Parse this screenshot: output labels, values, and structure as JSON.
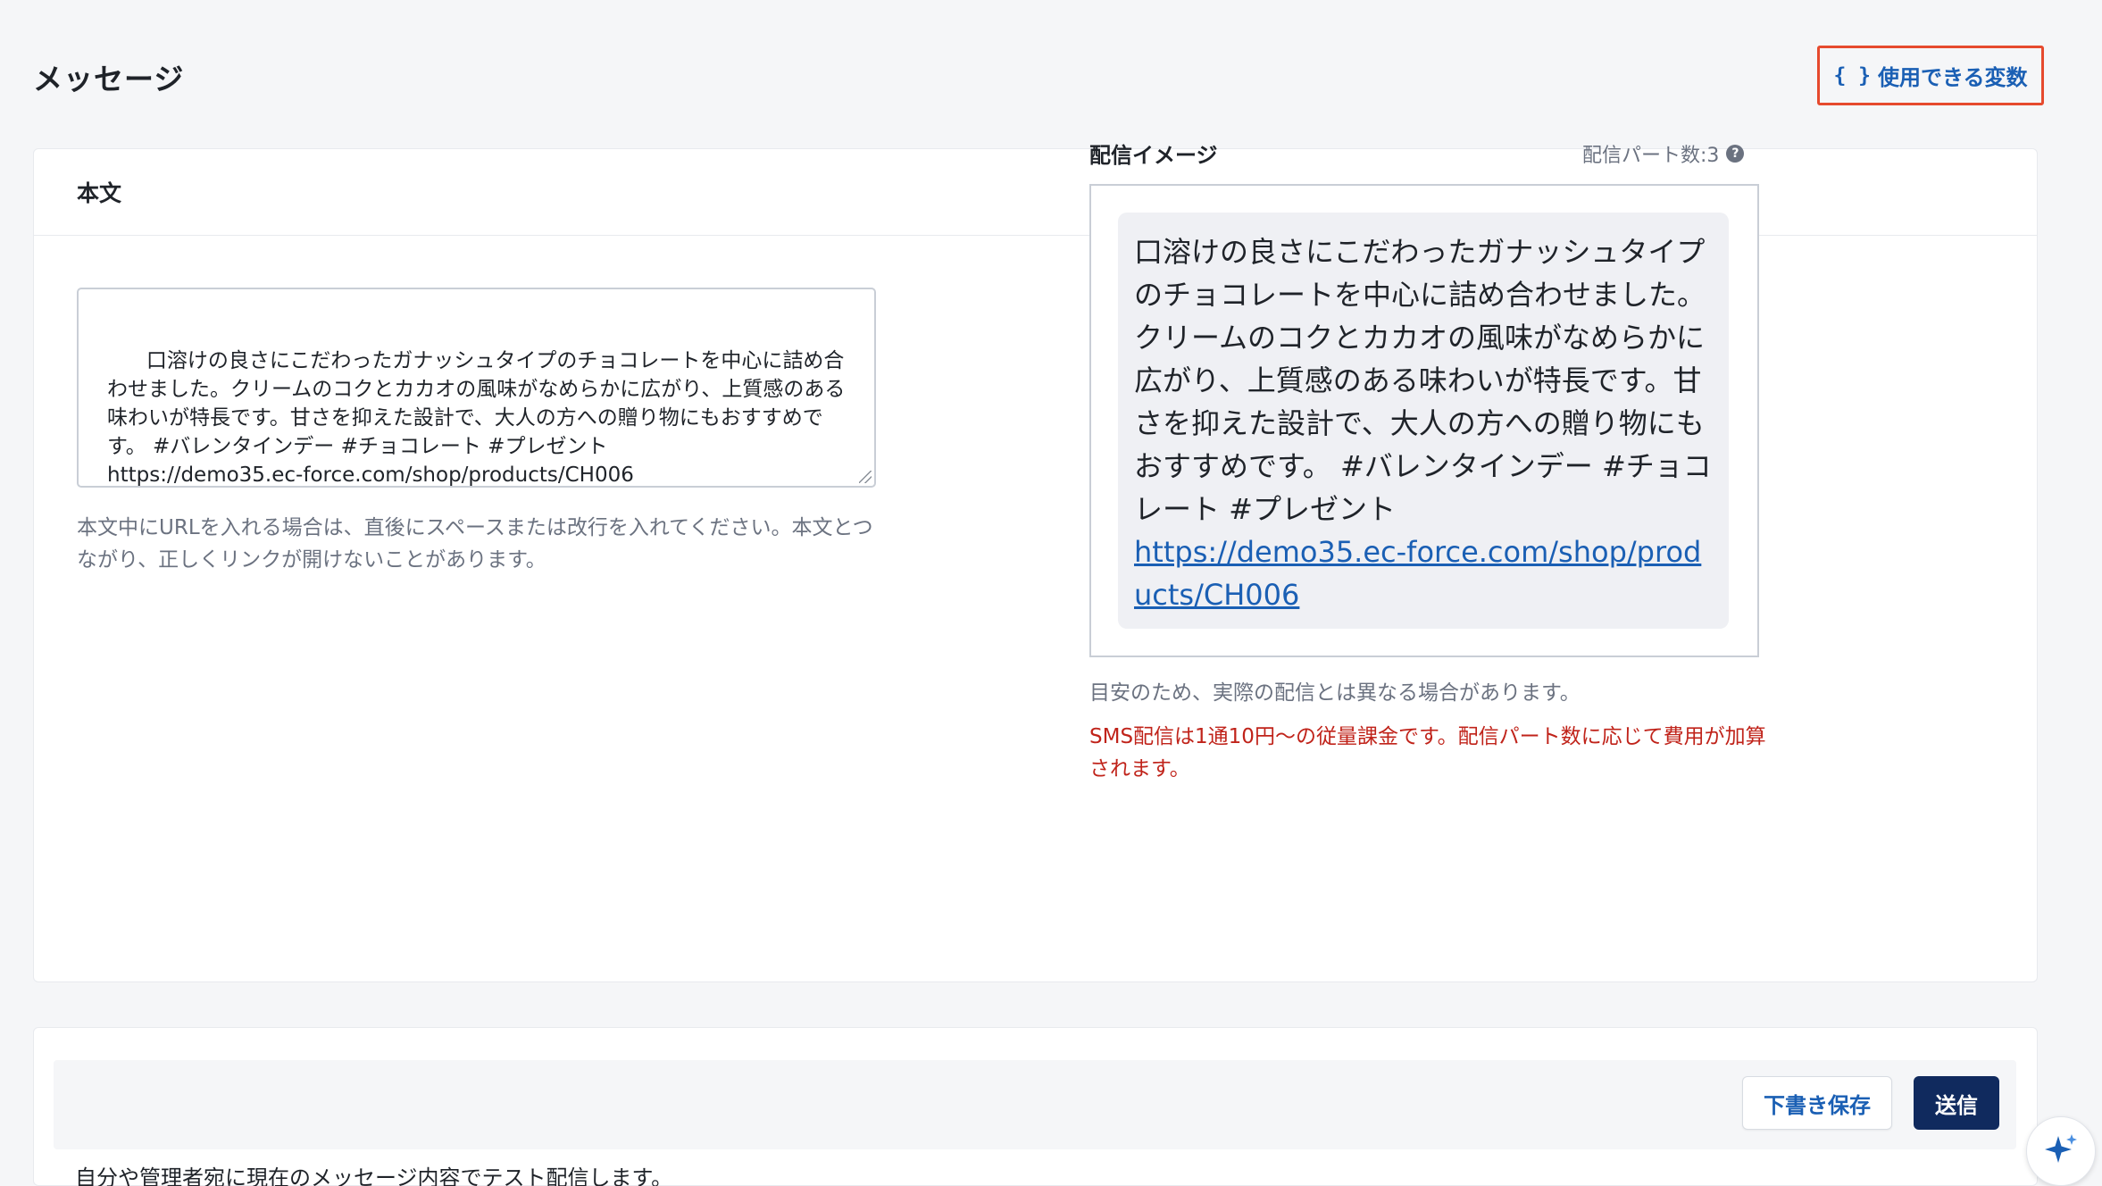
{
  "header": {
    "title": "メッセージ",
    "vars_button_brace": "{ }",
    "vars_button_label": "使用できる変数"
  },
  "body_card": {
    "title": "本文",
    "message_text": "口溶けの良さにこだわったガナッシュタイプのチョコレートを中心に詰め合わせました。クリームのコクとカカオの風味がなめらかに広がり、上質感のある味わいが特長です。甘さを抑えた設計で、大人の方への贈り物にもおすすめです。 #バレンタインデー #チョコレート #プレゼント\nhttps://demo35.ec-force.com/shop/products/CH006",
    "url_hint": "本文中にURLを入れる場合は、直後にスペースまたは改行を入れてください。本文とつながり、正しくリンクが開けないことがあります。"
  },
  "preview": {
    "label": "配信イメージ",
    "parts_count": "配信パート数:3",
    "help_icon_glyph": "?",
    "bubble_text": "口溶けの良さにこだわったガナッシュタイプのチョコレートを中心に詰め合わせました。クリームのコクとカカオの風味がなめらかに広がり、上質感のある味わいが特長です。甘さを抑えた設計で、大人の方への贈り物にもおすすめです。 #バレンタインデー #チョコレート #プレゼント",
    "bubble_link": "https://demo35.ec-force.com/shop/products/CH006",
    "note": "目安のため、実際の配信とは異なる場合があります。",
    "sms_warning": "SMS配信は1通10円〜の従量課金です。配信パート数に応じて費用が加算されます。"
  },
  "footer": {
    "draft_label": "下書き保存",
    "send_label": "送信",
    "test_hint": "自分や管理者宛に現在のメッセージ内容でテスト配信します。"
  },
  "colors": {
    "accent": "#1a5fb4",
    "primary_button": "#102a5e",
    "warning": "#c0231a",
    "highlight_border": "#e64a2e"
  }
}
